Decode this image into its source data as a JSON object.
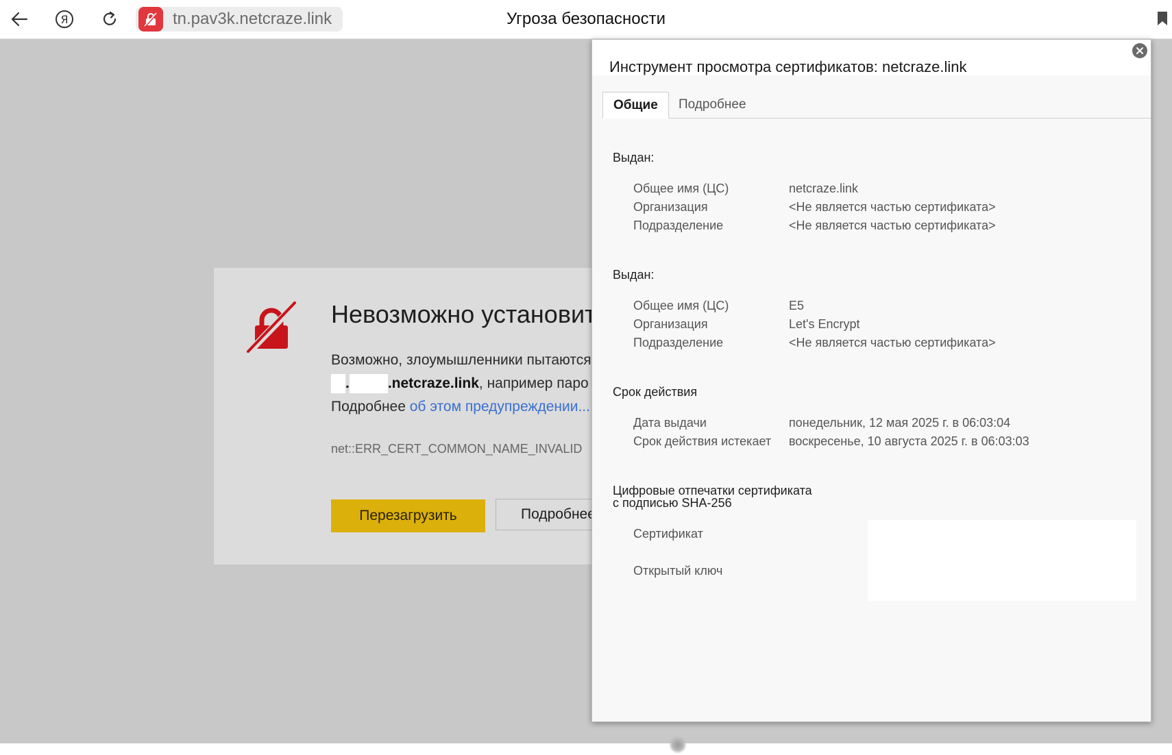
{
  "toolbar": {
    "url": "tn.pav3k.netcraze.link",
    "page_title": "Угроза безопасности",
    "icons": {
      "back": "back-arrow-icon",
      "yandex": "yandex-logo-icon",
      "reload": "reload-icon",
      "security": "security-warning-icon",
      "bookmark": "bookmark-icon"
    }
  },
  "error": {
    "title": "Невозможно установить",
    "text_line1": "Возможно, злоумышленники пытаются",
    "text_line2_dot": ".",
    "text_line2_domain": ".netcraze.link",
    "text_line2_rest": ", например паро",
    "text_line3_prefix": "Подробнее ",
    "text_line3_link": "об этом предупреждении",
    "text_line3_suffix": "...",
    "code": "net::ERR_CERT_COMMON_NAME_INVALID",
    "reload_button": "Перезагрузить",
    "details_button": "Подробнее"
  },
  "cert_viewer": {
    "title": "Инструмент просмотра сертификатов: netcraze.link",
    "tabs": [
      "Общие",
      "Подробнее"
    ],
    "active_tab": "Общие",
    "issued_to": {
      "heading": "Выдан:",
      "rows": [
        {
          "label": "Общее имя (ЦС)",
          "value": "netcraze.link"
        },
        {
          "label": "Организация",
          "value": "<Не является частью сертификата>"
        },
        {
          "label": "Подразделение",
          "value": "<Не является частью сертификата>"
        }
      ]
    },
    "issued_by": {
      "heading": "Выдан:",
      "rows": [
        {
          "label": "Общее имя (ЦС)",
          "value": "E5"
        },
        {
          "label": "Организация",
          "value": "Let's Encrypt"
        },
        {
          "label": "Подразделение",
          "value": "<Не является частью сертификата>"
        }
      ]
    },
    "validity": {
      "heading": "Срок действия",
      "rows": [
        {
          "label": "Дата выдачи",
          "value": "понедельник, 12 мая 2025 г. в 06:03:04"
        },
        {
          "label": "Срок действия истекает",
          "value": "воскресенье, 10 августа 2025 г. в 06:03:03"
        }
      ]
    },
    "fingerprints": {
      "heading_line1": "Цифровые отпечатки сертификата",
      "heading_line2": "с подписью SHA-256",
      "certificate_label": "Сертификат",
      "public_key_label": "Открытый ключ"
    }
  }
}
